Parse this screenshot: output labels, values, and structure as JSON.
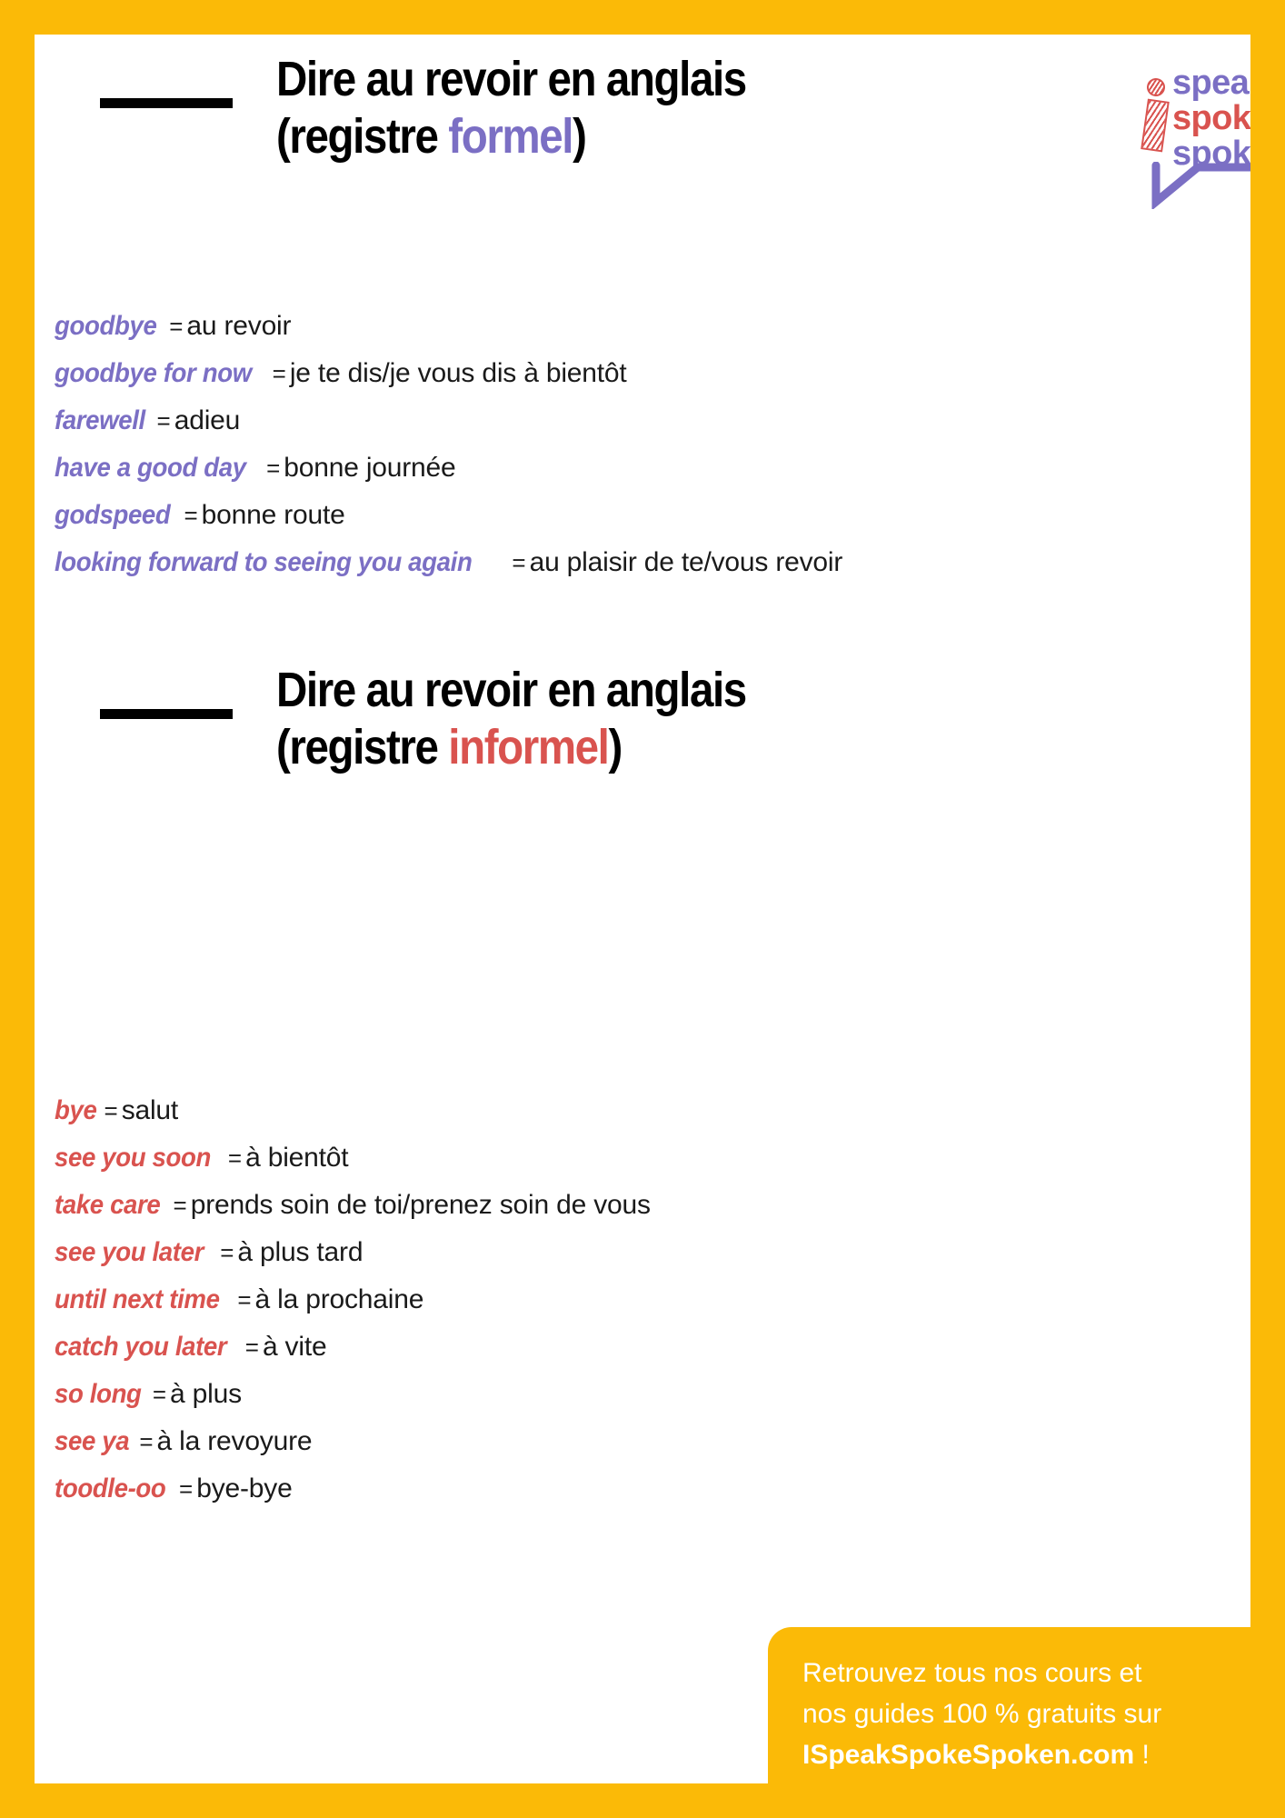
{
  "colors": {
    "frame_yellow": "#FBBA07",
    "purple": "#7B6FC4",
    "red": "#D9534F",
    "black": "#000000",
    "white": "#FFFFFF"
  },
  "logo": {
    "line1": "speak",
    "line2": "spoke",
    "line3": "spoken"
  },
  "sections": [
    {
      "title_line1": "Dire au revoir en anglais",
      "title_line2_prefix": "(registre ",
      "title_line2_accent": "formel",
      "title_line2_suffix": ")",
      "register": "formel",
      "entries": [
        {
          "term": "goodbye",
          "eq": "=",
          "translation": "au revoir"
        },
        {
          "term": "goodbye for now",
          "eq": "=",
          "translation": "je te dis/je vous dis à bientôt"
        },
        {
          "term": "farewell",
          "eq": "=",
          "translation": "adieu"
        },
        {
          "term": "have a good day",
          "eq": "=",
          "translation": "bonne journée"
        },
        {
          "term": "godspeed",
          "eq": "=",
          "translation": "bonne route"
        },
        {
          "term": "looking forward to seeing you again",
          "eq": "=",
          "translation": "au plaisir de te/vous revoir"
        }
      ]
    },
    {
      "title_line1": "Dire au revoir en anglais",
      "title_line2_prefix": "(registre ",
      "title_line2_accent": "informel",
      "title_line2_suffix": ")",
      "register": "informel",
      "entries": [
        {
          "term": "bye",
          "eq": "=",
          "translation": "salut"
        },
        {
          "term": "see you soon",
          "eq": "=",
          "translation": "à bientôt"
        },
        {
          "term": "take care",
          "eq": "=",
          "translation": "prends soin de toi/prenez soin de vous"
        },
        {
          "term": "see you later",
          "eq": "=",
          "translation": "à plus tard"
        },
        {
          "term": "until next time",
          "eq": "=",
          "translation": "à la prochaine"
        },
        {
          "term": "catch you later",
          "eq": "=",
          "translation": "à vite"
        },
        {
          "term": "so long",
          "eq": "=",
          "translation": "à plus"
        },
        {
          "term": "see ya",
          "eq": "=",
          "translation": "à la revoyure"
        },
        {
          "term": "toodle-oo",
          "eq": "=",
          "translation": "bye-bye"
        }
      ]
    }
  ],
  "footer": {
    "line1": "Retrouvez tous nos cours et",
    "line2": "nos guides 100 % gratuits sur",
    "line3_strong": "ISpeakSpokeSpoken.com",
    "line3_suffix": " !"
  }
}
